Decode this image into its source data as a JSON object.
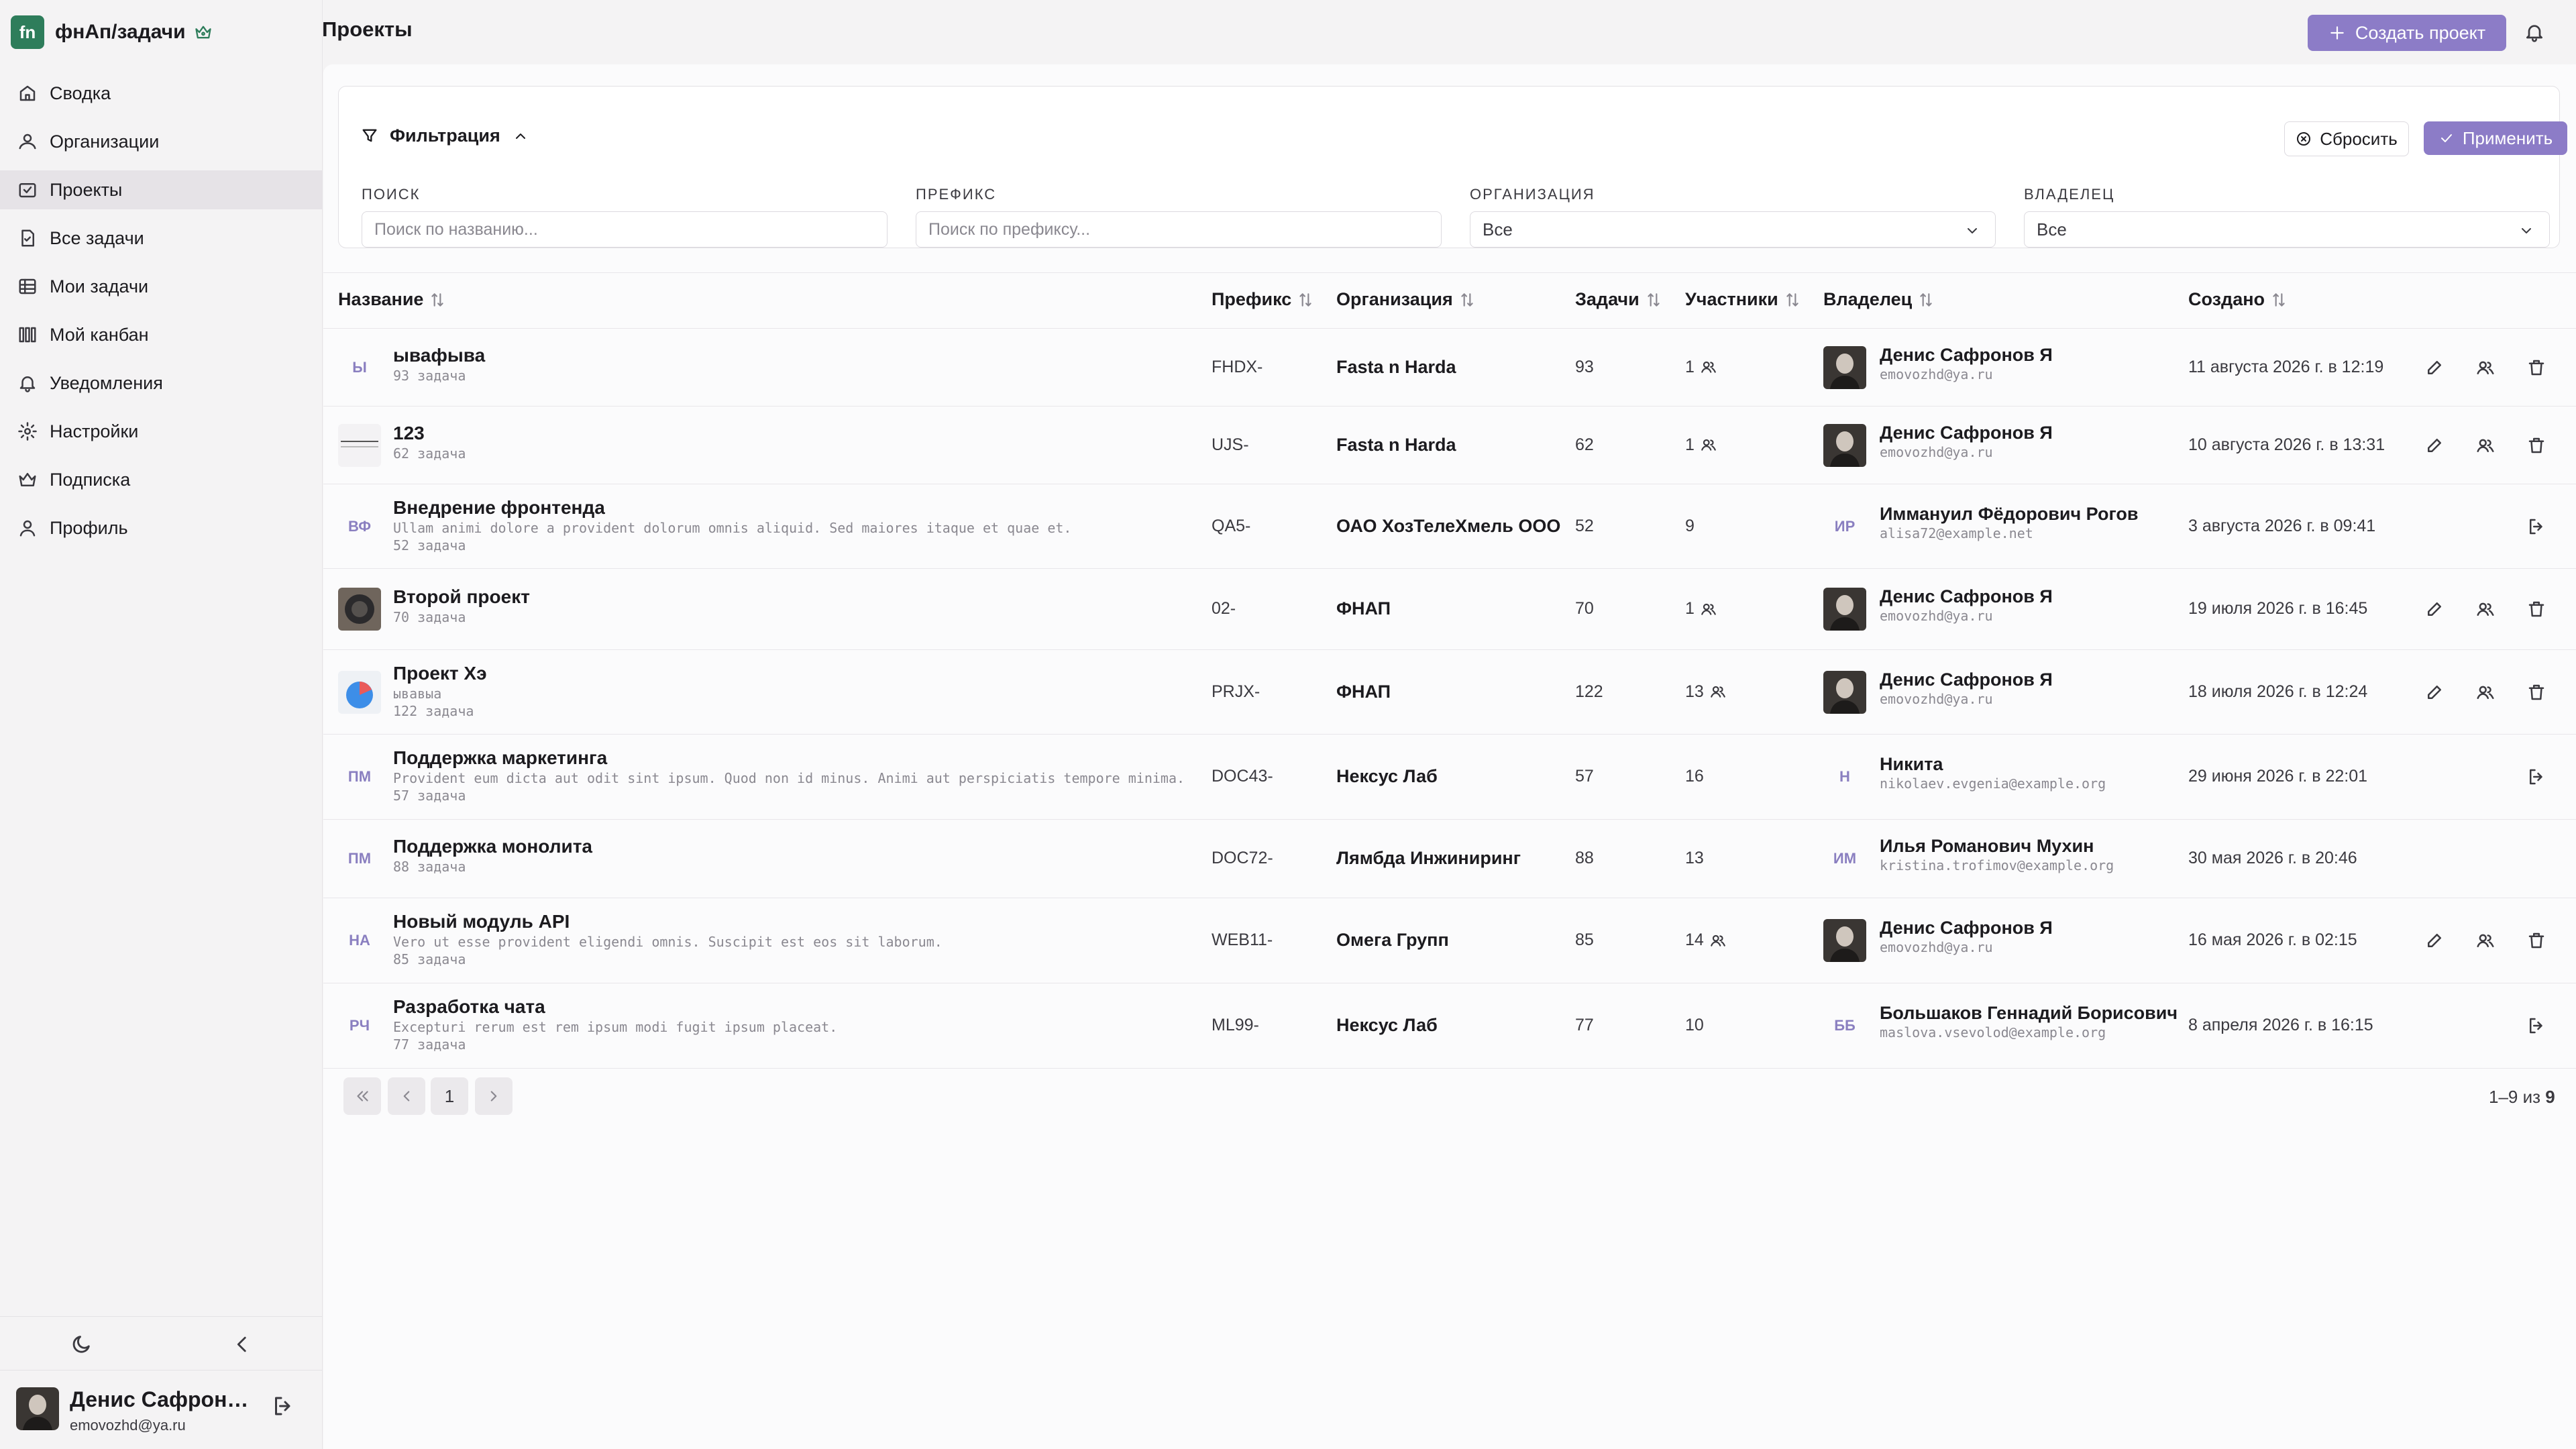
{
  "brand": {
    "logo": "fn",
    "name": "фнАп/задачи"
  },
  "nav": [
    {
      "label": "Сводка",
      "icon": "home-icon"
    },
    {
      "label": "Организации",
      "icon": "organizations-icon"
    },
    {
      "label": "Проекты",
      "icon": "projects-icon",
      "active": true
    },
    {
      "label": "Все задачи",
      "icon": "tasks-icon"
    },
    {
      "label": "Мои задачи",
      "icon": "my-tasks-icon"
    },
    {
      "label": "Мой канбан",
      "icon": "kanban-icon"
    },
    {
      "label": "Уведомления",
      "icon": "bell-icon"
    },
    {
      "label": "Настройки",
      "icon": "gear-icon"
    },
    {
      "label": "Подписка",
      "icon": "crown-icon"
    },
    {
      "label": "Профиль",
      "icon": "user-icon"
    }
  ],
  "sidebar_user": {
    "name": "Денис Сафронов Я",
    "email": "emovozhd@ya.ru"
  },
  "header": {
    "title": "Проекты",
    "create_label": "Создать проект"
  },
  "filters": {
    "title": "Фильтрация",
    "reset_label": "Сбросить",
    "apply_label": "Применить",
    "search_label": "ПОИСК",
    "search_placeholder": "Поиск по названию...",
    "prefix_label": "ПРЕФИКС",
    "prefix_placeholder": "Поиск по префиксу...",
    "org_label": "ОРГАНИЗАЦИЯ",
    "org_value": "Все",
    "owner_label": "ВЛАДЕЛЕЦ",
    "owner_value": "Все"
  },
  "table": {
    "columns": {
      "name": "Название",
      "prefix": "Префикс",
      "org": "Организация",
      "tasks": "Задачи",
      "members": "Участники",
      "owner": "Владелец",
      "created": "Создано"
    },
    "rows": [
      {
        "icon": "Ы",
        "icon_type": "initials",
        "name": "ывафыва",
        "desc": "",
        "task_count": "93 задача",
        "prefix": "FHDX-",
        "org": "Fasta n Harda",
        "tasks": "93",
        "members": "1",
        "owner": "Денис Сафронов Я",
        "owner_email": "emovozhd@ya.ru",
        "owner_initials": "",
        "created": "11 августа 2026 г. в 12:19",
        "actions": "edit"
      },
      {
        "icon": "",
        "icon_type": "image-lines",
        "name": "123",
        "desc": "",
        "task_count": "62 задача",
        "prefix": "UJS-",
        "org": "Fasta n Harda",
        "tasks": "62",
        "members": "1",
        "owner": "Денис Сафронов Я",
        "owner_email": "emovozhd@ya.ru",
        "owner_initials": "",
        "created": "10 августа 2026 г. в 13:31",
        "actions": "edit"
      },
      {
        "icon": "ВФ",
        "icon_type": "initials",
        "name": "Внедрение фронтенда",
        "desc": "Ullam animi dolore a provident dolorum omnis aliquid. Sed maiores itaque et quae et.",
        "task_count": "52 задача",
        "prefix": "QA5-",
        "org": "ОАО ХозТелеХмель ООО",
        "tasks": "52",
        "members": "9",
        "owner": "Иммануил Фёдорович Рогов",
        "owner_email": "alisa72@example.net",
        "owner_initials": "ИР",
        "created": "3 августа 2026 г. в 09:41",
        "actions": "leave"
      },
      {
        "icon": "",
        "icon_type": "image-dark",
        "name": "Второй проект",
        "desc": "",
        "task_count": "70 задача",
        "prefix": "02-",
        "org": "ФНАП",
        "tasks": "70",
        "members": "1",
        "owner": "Денис Сафронов Я",
        "owner_email": "emovozhd@ya.ru",
        "owner_initials": "",
        "created": "19 июля 2026 г. в 16:45",
        "actions": "edit"
      },
      {
        "icon": "",
        "icon_type": "image-pie",
        "name": "Проект Хэ",
        "desc": "ывавыа",
        "task_count": "122 задача",
        "prefix": "PRJX-",
        "org": "ФНАП",
        "tasks": "122",
        "members": "13",
        "owner": "Денис Сафронов Я",
        "owner_email": "emovozhd@ya.ru",
        "owner_initials": "",
        "created": "18 июля 2026 г. в 12:24",
        "actions": "edit"
      },
      {
        "icon": "ПМ",
        "icon_type": "initials",
        "name": "Поддержка маркетинга",
        "desc": "Provident eum dicta aut odit sint ipsum. Quod non id minus. Animi aut perspiciatis tempore minima.",
        "task_count": "57 задача",
        "prefix": "DOC43-",
        "org": "Нексус Лаб",
        "tasks": "57",
        "members": "16",
        "owner": "Никита",
        "owner_email": "nikolaev.evgenia@example.org",
        "owner_initials": "Н",
        "created": "29 июня 2026 г. в 22:01",
        "actions": "leave"
      },
      {
        "icon": "ПМ",
        "icon_type": "initials",
        "name": "Поддержка монолита",
        "desc": "",
        "task_count": "88 задача",
        "prefix": "DOC72-",
        "org": "Лямбда Инжиниринг",
        "tasks": "88",
        "members": "13",
        "owner": "Илья Романович Мухин",
        "owner_email": "kristina.trofimov@example.org",
        "owner_initials": "ИМ",
        "created": "30 мая 2026 г. в 20:46",
        "actions": "none"
      },
      {
        "icon": "НА",
        "icon_type": "initials",
        "name": "Новый модуль API",
        "desc": "Vero ut esse provident eligendi omnis. Suscipit est eos sit laborum.",
        "task_count": "85 задача",
        "prefix": "WEB11-",
        "org": "Омега Групп",
        "tasks": "85",
        "members": "14",
        "owner": "Денис Сафронов Я",
        "owner_email": "emovozhd@ya.ru",
        "owner_initials": "",
        "created": "16 мая 2026 г. в 02:15",
        "actions": "edit"
      },
      {
        "icon": "РЧ",
        "icon_type": "initials",
        "name": "Разработка чата",
        "desc": "Excepturi rerum est rem ipsum modi fugit ipsum placeat.",
        "task_count": "77 задача",
        "prefix": "ML99-",
        "org": "Нексус Лаб",
        "tasks": "77",
        "members": "10",
        "owner": "Большаков Геннадий Борисович",
        "owner_email": "maslova.vsevolod@example.org",
        "owner_initials": "ББ",
        "created": "8 апреля 2026 г. в 16:15",
        "actions": "leave"
      }
    ]
  },
  "pagination": {
    "current": "1",
    "summary_prefix": "1–9 из ",
    "summary_total": "9"
  },
  "colors": {
    "accent": "#8c7cc7",
    "brand": "#2e7d5b",
    "muted": "#8a8890"
  }
}
